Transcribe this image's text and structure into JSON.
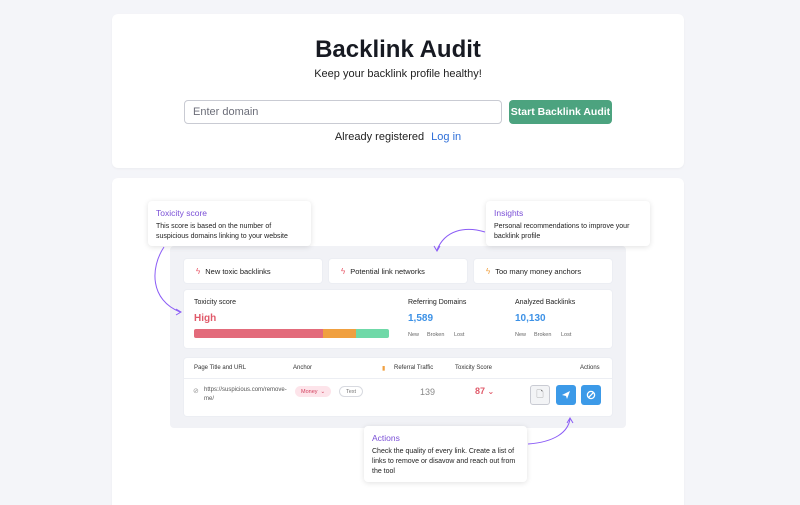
{
  "header": {
    "title": "Backlink Audit",
    "subtitle": "Keep your backlink profile healthy!",
    "domain_placeholder": "Enter domain",
    "start_button": "Start Backlink Audit",
    "already_registered": "Already registered",
    "login_link": "Log in"
  },
  "callouts": {
    "toxicity": {
      "title": "Toxicity score",
      "body": "This score is based on the number of suspicious domains linking to your website"
    },
    "insights": {
      "title": "Insights",
      "body": "Personal recommendations to improve your backlink profile"
    },
    "actions": {
      "title": "Actions",
      "body": "Check the quality of every link. Create a list of links to remove or disavow and reach out from the tool"
    }
  },
  "alerts": [
    {
      "label": "New toxic backlinks",
      "icon": "bolt-icon",
      "color": "#e85a6a"
    },
    {
      "label": "Potential link networks",
      "icon": "bolt-icon",
      "color": "#e85a6a"
    },
    {
      "label": "Too many money anchors",
      "icon": "bolt-icon",
      "color": "#f0a040"
    }
  ],
  "stats": {
    "toxicity_label": "Toxicity score",
    "toxicity_value": "High",
    "toxicity_bar": {
      "red": 0.66,
      "orange": 0.17,
      "green": 0.17
    },
    "referring_label": "Referring Domains",
    "referring_value": "1,589",
    "analyzed_label": "Analyzed Backlinks",
    "analyzed_value": "10,130",
    "sub_new": "New",
    "sub_broken": "Broken",
    "sub_lost": "Lost"
  },
  "table": {
    "headers": {
      "page": "Page Title and URL",
      "anchor": "Anchor",
      "traffic": "Referral Traffic",
      "toxicity": "Toxicity Score",
      "actions": "Actions"
    },
    "row": {
      "url": "https://suspicious.com/remove-me/",
      "tag_money": "Money",
      "tag_text": "Text",
      "traffic": "139",
      "toxicity": "87"
    }
  },
  "colors": {
    "brand_green": "#4ca37f",
    "link_blue": "#2f6fd8",
    "accent_purple": "#7a4fd6",
    "danger_red": "#e05a6a",
    "metric_blue": "#3c91e6"
  }
}
